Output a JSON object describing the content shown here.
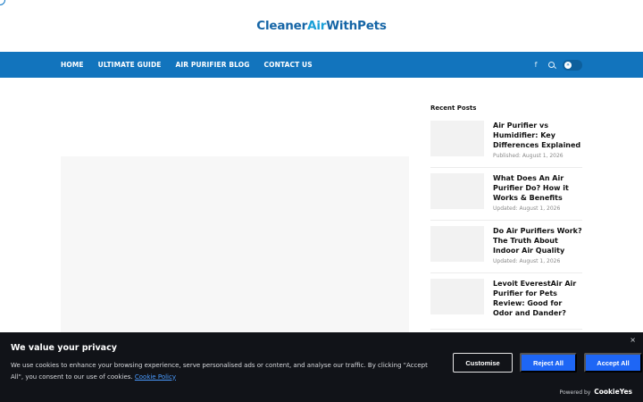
{
  "logo": {
    "part1": "Cleaner",
    "part2": "Air",
    "part3": "WithPets"
  },
  "nav": {
    "links": [
      "HOME",
      "ULTIMATE GUIDE",
      "AIR PURIFIER BLOG",
      "CONTACT US"
    ],
    "facebook_glyph": "f",
    "toggle_glyph": "☀"
  },
  "sidebar": {
    "title": "Recent Posts",
    "posts": [
      {
        "title": "Air Purifier vs Humidifier: Key Differences Explained",
        "meta": "Published: August 1, 2026"
      },
      {
        "title": "What Does An Air Purifier Do? How it Works & Benefits",
        "meta": "Updated: August 1, 2026"
      },
      {
        "title": "Do Air Purifiers Work? The Truth About Indoor Air Quality",
        "meta": "Updated: August 1, 2026"
      },
      {
        "title": "Levoit EverestAir Air Purifier for Pets Review: Good for Odor and Dander?",
        "meta": ""
      }
    ]
  },
  "cookie": {
    "title": "We value your privacy",
    "text": "We use cookies to enhance your browsing experience, serve personalised ads or content, and analyse our traffic. By clicking \"Accept All\", you consent to our use of cookies.",
    "policy_link": "Cookie Policy",
    "customise_label": "Customise",
    "reject_label": "Reject All",
    "accept_label": "Accept All",
    "powered_by": "Powered by",
    "powered_brand": "CookieYes",
    "close_glyph": "×"
  },
  "colors": {
    "nav_bg": "#1274bd",
    "accent_blue": "#1e66f5",
    "banner_bg": "#111318"
  }
}
